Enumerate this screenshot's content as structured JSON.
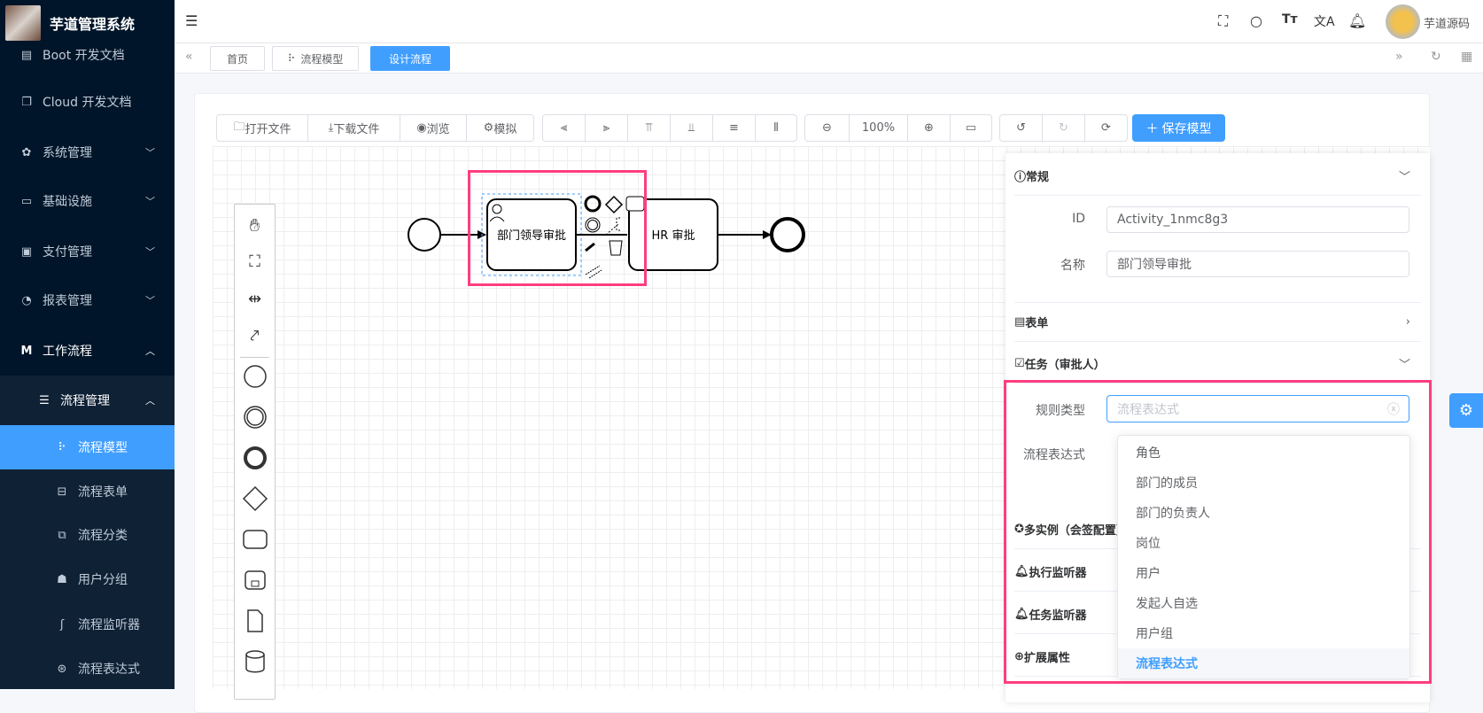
{
  "app": {
    "title": "芋道管理系统"
  },
  "sidebar": {
    "items": [
      {
        "label": "Boot 开发文档",
        "icon": "document-icon"
      },
      {
        "label": "Cloud 开发文档",
        "icon": "copy-document-icon"
      },
      {
        "label": "系统管理",
        "icon": "gear-icon"
      },
      {
        "label": "基础设施",
        "icon": "monitor-icon"
      },
      {
        "label": "支付管理",
        "icon": "wallet-icon"
      },
      {
        "label": "报表管理",
        "icon": "pie-chart-icon"
      },
      {
        "label": "工作流程",
        "icon": "logo-m-icon"
      },
      {
        "label": "流程管理",
        "icon": "list-icon"
      },
      {
        "label": "流程模型",
        "icon": "network-icon",
        "active": true
      },
      {
        "label": "流程表单",
        "icon": "drive-icon"
      },
      {
        "label": "流程分类",
        "icon": "category-icon"
      },
      {
        "label": "用户分组",
        "icon": "user-group-icon"
      },
      {
        "label": "流程监听器",
        "icon": "ear-icon"
      },
      {
        "label": "流程表达式",
        "icon": "expression-icon"
      }
    ]
  },
  "header": {
    "user": "芋道源码",
    "icons": [
      "fullscreen-icon",
      "search-icon",
      "font-size-icon",
      "translate-icon",
      "bell-icon"
    ]
  },
  "tabs": [
    {
      "label": "首页"
    },
    {
      "label": "流程模型"
    },
    {
      "label": "设计流程",
      "active": true
    }
  ],
  "toolbar": {
    "open": "打开文件",
    "download": "下载文件",
    "preview": "浏览",
    "simulate": "模拟",
    "zoom": "100%",
    "save": "保存模型"
  },
  "diagram": {
    "task1": "部门领导审批",
    "task2": "HR 审批"
  },
  "panel": {
    "general": {
      "title": "常规",
      "id_label": "ID",
      "id_value": "Activity_1nmc8g3",
      "name_label": "名称",
      "name_value": "部门领导审批"
    },
    "form": {
      "title": "表单"
    },
    "task": {
      "title": "任务（审批人）",
      "rule_label": "规则类型",
      "rule_placeholder": "流程表达式",
      "expr_label": "流程表达式"
    },
    "multi": {
      "title": "多实例（会签配置）"
    },
    "exec_listener": {
      "title": "执行监听器"
    },
    "task_listener": {
      "title": "任务监听器"
    },
    "ext": {
      "title": "扩展属性"
    }
  },
  "dropdown": {
    "options": [
      "角色",
      "部门的成员",
      "部门的负责人",
      "岗位",
      "用户",
      "发起人自选",
      "用户组",
      "流程表达式"
    ],
    "selected": "流程表达式"
  },
  "colors": {
    "primary": "#409eff",
    "sidebar": "#001529",
    "highlight": "#ff3d7f"
  }
}
